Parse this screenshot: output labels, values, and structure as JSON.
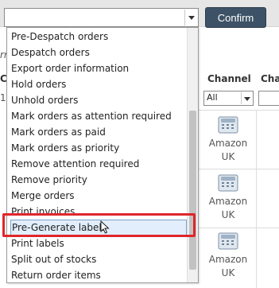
{
  "toolbar": {
    "select_value": "",
    "confirm_label": "Confirm"
  },
  "background": {
    "side_fragments": [
      "rn",
      "C",
      "1"
    ],
    "headers": {
      "channel": "Channel",
      "channel_partial": "Cha"
    },
    "filter_value": "All",
    "rows": [
      {
        "line1": "Amazon",
        "line2": "UK"
      },
      {
        "line1": "Amazon",
        "line2": "UK"
      },
      {
        "line1": "Amazon",
        "line2": "UK"
      }
    ]
  },
  "dropdown": {
    "options": [
      "Pre-Despatch orders",
      "Despatch orders",
      "Export order information",
      "Hold orders",
      "Unhold orders",
      "Mark orders as attention required",
      "Mark orders as paid",
      "Mark orders as priority",
      "Remove attention required",
      "Remove priority",
      "Merge orders",
      "Print invoices",
      "Pre-Generate labels",
      "Print labels",
      "Split out of stocks",
      "Return order items"
    ],
    "selected_index": 12
  },
  "colors": {
    "confirm_bg": "#3d5266",
    "highlight": "#e0262b",
    "selected_bg": "#e2eefb"
  },
  "icons": [
    "chevron-down-icon",
    "phone-icon",
    "mouse-cursor-icon"
  ]
}
